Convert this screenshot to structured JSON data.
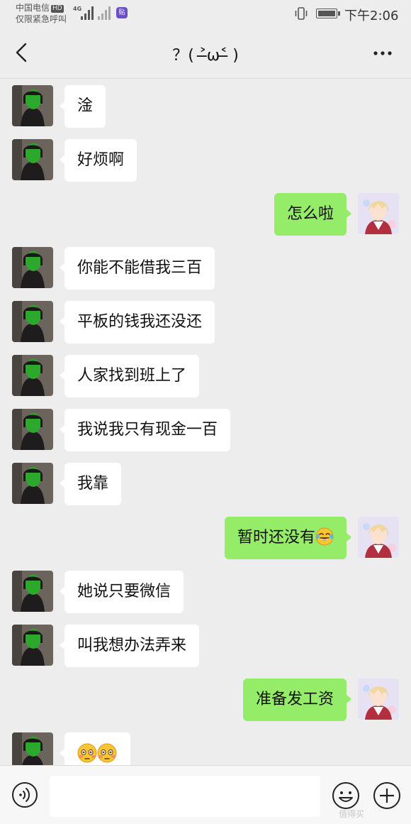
{
  "status_bar": {
    "carrier": "中国电信",
    "hd_badge": "HD",
    "network": "4G",
    "emergency_text": "仅限紧急呼叫",
    "app_badge": "贴",
    "time": "下午2:06"
  },
  "header": {
    "title": "？( ˃̶ω˂̶ )"
  },
  "messages": [
    {
      "side": "left",
      "text": "淦"
    },
    {
      "side": "left",
      "text": "好烦啊"
    },
    {
      "side": "right",
      "text": "怎么啦"
    },
    {
      "side": "left",
      "text": "你能不能借我三百"
    },
    {
      "side": "left",
      "text": "平板的钱我还没还"
    },
    {
      "side": "left",
      "text": "人家找到班上了"
    },
    {
      "side": "left",
      "text": "我说我只有现金一百"
    },
    {
      "side": "left",
      "text": "我靠"
    },
    {
      "side": "right",
      "text": "暂时还没有",
      "emoji": "tears-of-joy-emoji"
    },
    {
      "side": "left",
      "text": "她说只要微信"
    },
    {
      "side": "left",
      "text": "叫我想办法弄来"
    },
    {
      "side": "right",
      "text": "准备发工资"
    },
    {
      "side": "left",
      "text": "",
      "emoji": "flushed-emoji-pair"
    }
  ],
  "input_bar": {
    "voice_icon": "voice-icon",
    "emoji_icon": "emoji-icon",
    "plus_icon": "plus-icon"
  },
  "watermark": "值得买",
  "colors": {
    "background": "#ededed",
    "left_bubble": "#ffffff",
    "right_bubble": "#95ec69"
  }
}
